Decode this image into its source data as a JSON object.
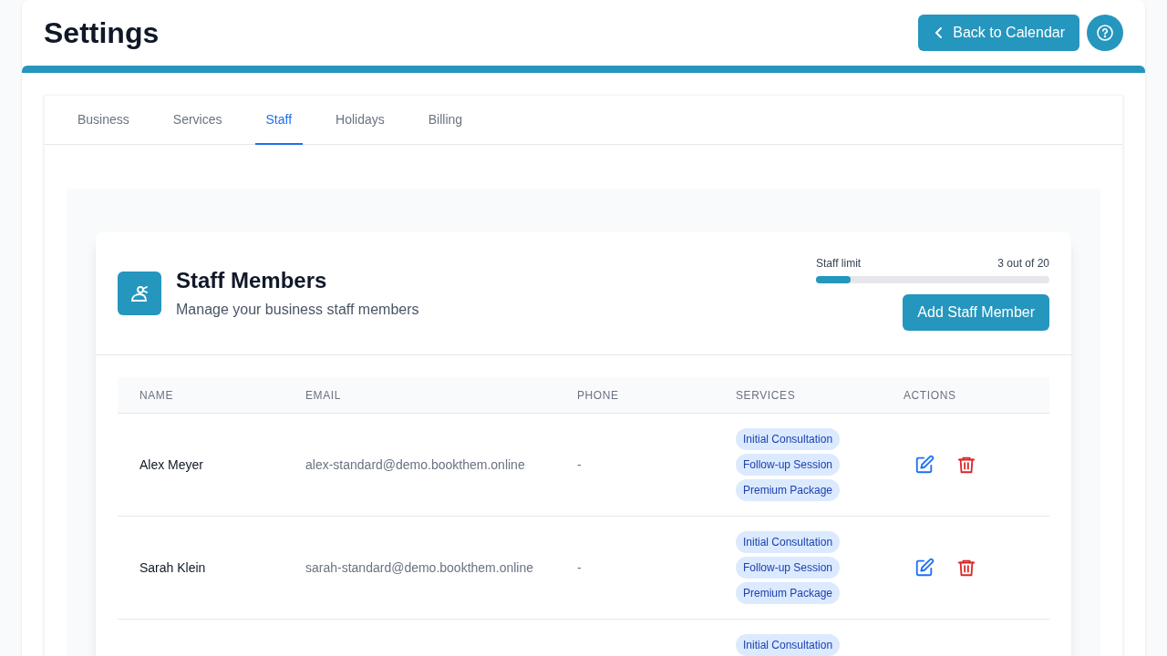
{
  "page": {
    "title": "Settings",
    "back_button": "Back to Calendar"
  },
  "tabs": [
    {
      "label": "Business",
      "selected": false
    },
    {
      "label": "Services",
      "selected": false
    },
    {
      "label": "Staff",
      "selected": true
    },
    {
      "label": "Holidays",
      "selected": false
    },
    {
      "label": "Billing",
      "selected": false
    }
  ],
  "staff_panel": {
    "title": "Staff Members",
    "subtitle": "Manage your business staff members",
    "limit_label": "Staff limit",
    "limit_reading": "3 out of 20",
    "level": 0.15,
    "add_button": "Add Staff Member"
  },
  "table": {
    "columns": [
      "NAME",
      "EMAIL",
      "PHONE",
      "SERVICES",
      "ACTIONS"
    ],
    "rows": [
      {
        "name": "Alex Meyer",
        "email": "alex-standard@demo.bookthem.online",
        "phone": "-",
        "services": [
          "Initial Consultation",
          "Follow-up Session",
          "Premium Package"
        ]
      },
      {
        "name": "Sarah Klein",
        "email": "sarah-standard@demo.bookthem.online",
        "phone": "-",
        "services": [
          "Initial Consultation",
          "Follow-up Session",
          "Premium Package"
        ]
      },
      {
        "services": [
          "Initial Consultation"
        ]
      }
    ]
  }
}
